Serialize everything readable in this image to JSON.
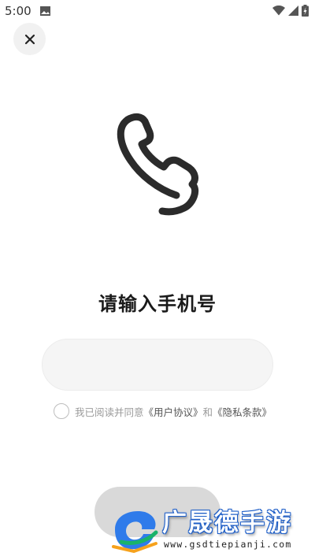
{
  "status_bar": {
    "time": "5:00",
    "icons": [
      "photo-icon",
      "wifi-icon",
      "signal-icon",
      "battery-charging-icon"
    ]
  },
  "close_button": {
    "icon": "close-icon"
  },
  "illustration": {
    "icon": "phone-handset-icon"
  },
  "title": "请输入手机号",
  "phone_input": {
    "value": "",
    "placeholder": ""
  },
  "agreement": {
    "prefix": "我已阅读并同意",
    "user_agreement": "《用户协议》",
    "conjunction": "和",
    "privacy_policy": "《隐私条款》"
  },
  "watermark": {
    "title": "广晟德手游",
    "url": "www.gsdtiepianji.com"
  },
  "colors": {
    "background": "#ffffff",
    "input_background": "#f5f5f5",
    "button_disabled": "#d9d9d9",
    "icon_stroke": "#2b2b2b",
    "watermark_blue": "#1f5fc8"
  }
}
